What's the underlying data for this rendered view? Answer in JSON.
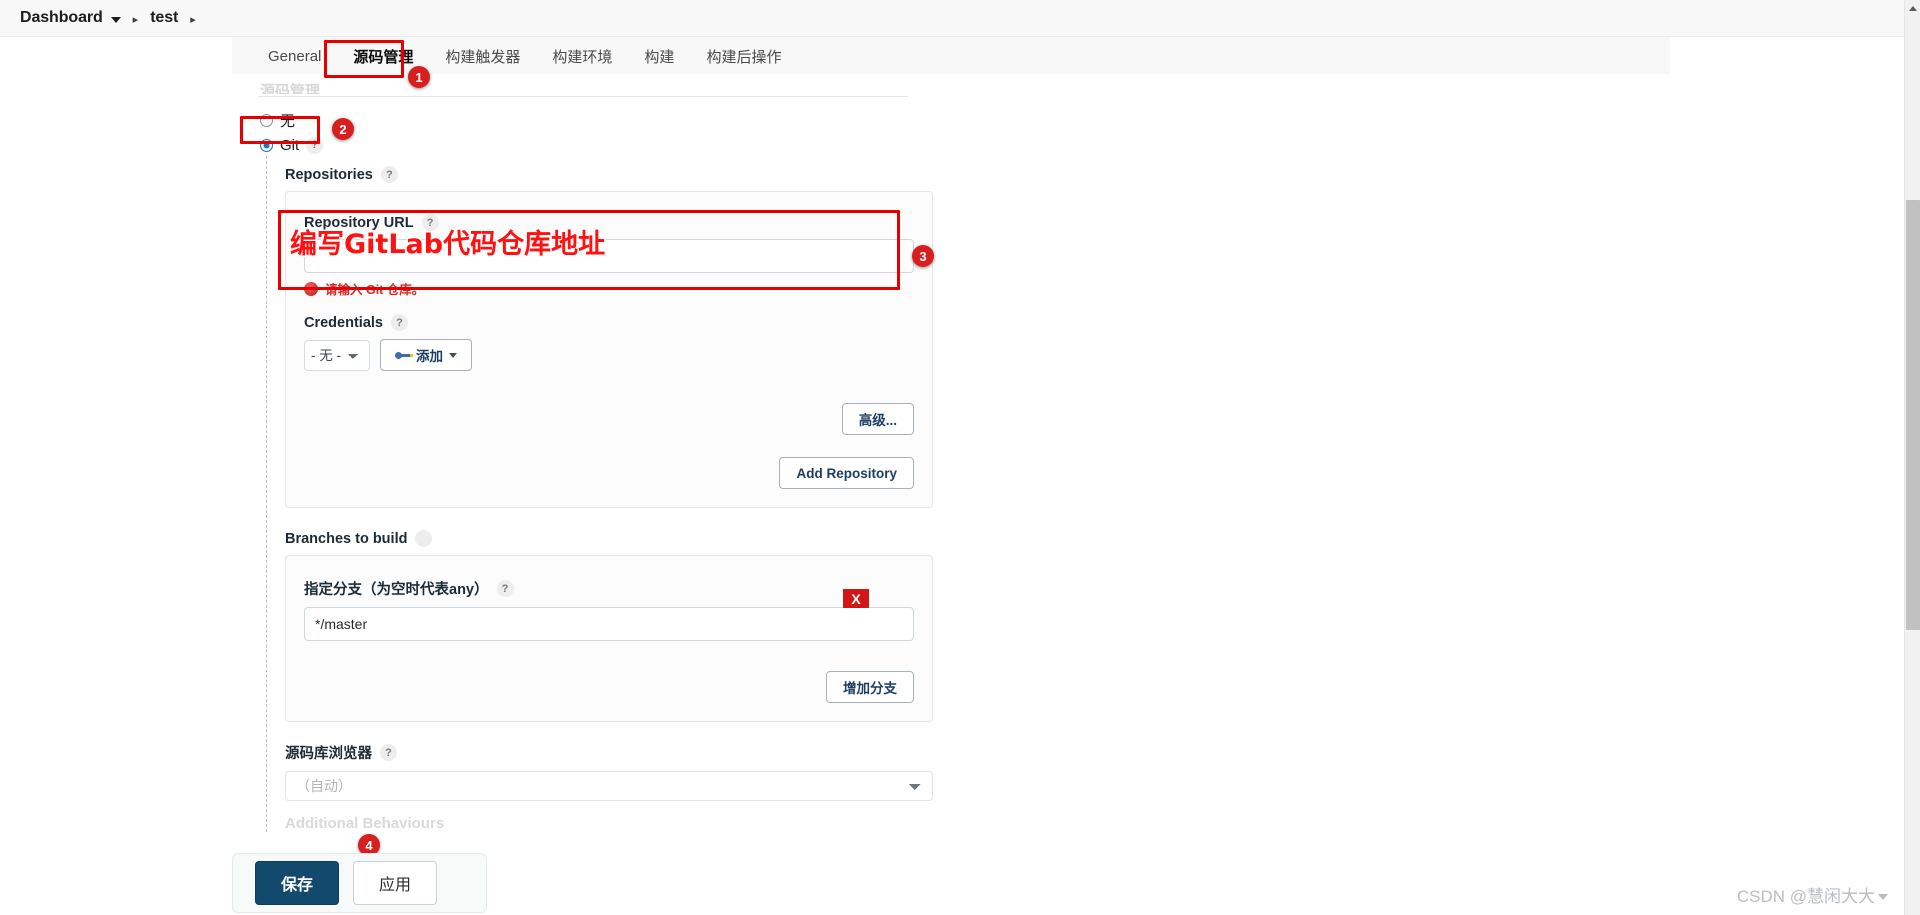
{
  "breadcrumb": {
    "items": [
      {
        "label": "Dashboard",
        "has_caret": true
      },
      {
        "label": "test",
        "has_caret": false
      }
    ],
    "separator": "▸"
  },
  "tabs": [
    {
      "label": "General",
      "active": false
    },
    {
      "label": "源码管理",
      "active": true
    },
    {
      "label": "构建触发器",
      "active": false
    },
    {
      "label": "构建环境",
      "active": false
    },
    {
      "label": "构建",
      "active": false
    },
    {
      "label": "构建后操作",
      "active": false
    }
  ],
  "scm": {
    "section_heading_faded": "源码管理",
    "options": [
      {
        "label": "无",
        "checked": false
      },
      {
        "label": "Git",
        "checked": true
      }
    ],
    "help_glyph": "?",
    "repositories_label": "Repositories",
    "repository_url_label": "Repository URL",
    "repository_url_value": "",
    "repository_url_placeholder": "",
    "repository_url_error": "请输入 Git 仓库。",
    "credentials_label": "Credentials",
    "credentials_selected": "- 无 -",
    "credentials_add_label": "添加",
    "advanced_button": "高级...",
    "add_repository_button": "Add Repository"
  },
  "branches": {
    "label": "Branches to build",
    "specifier_label": "指定分支（为空时代表any）",
    "specifier_value": "*/master",
    "add_branch_button": "增加分支",
    "delete_badge": "X"
  },
  "browser": {
    "label": "源码库浏览器",
    "selected": "（自动）"
  },
  "additional": {
    "label": "Additional Behaviours"
  },
  "footer": {
    "save_label": "保存",
    "apply_label": "应用"
  },
  "annotations": {
    "markers": [
      {
        "id": "1",
        "text": "1"
      },
      {
        "id": "2",
        "text": "2"
      },
      {
        "id": "3",
        "text": "3"
      },
      {
        "id": "4",
        "text": "4"
      }
    ],
    "red_note": "编写GitLab代码仓库地址"
  },
  "watermark": {
    "text": "CSDN @慧闲大大"
  },
  "colors": {
    "annotation_red": "#e60000",
    "marker_red": "#d81f1f",
    "primary_button": "#14496e",
    "error_red": "#d32a2a",
    "radio_blue": "#1675d1"
  }
}
